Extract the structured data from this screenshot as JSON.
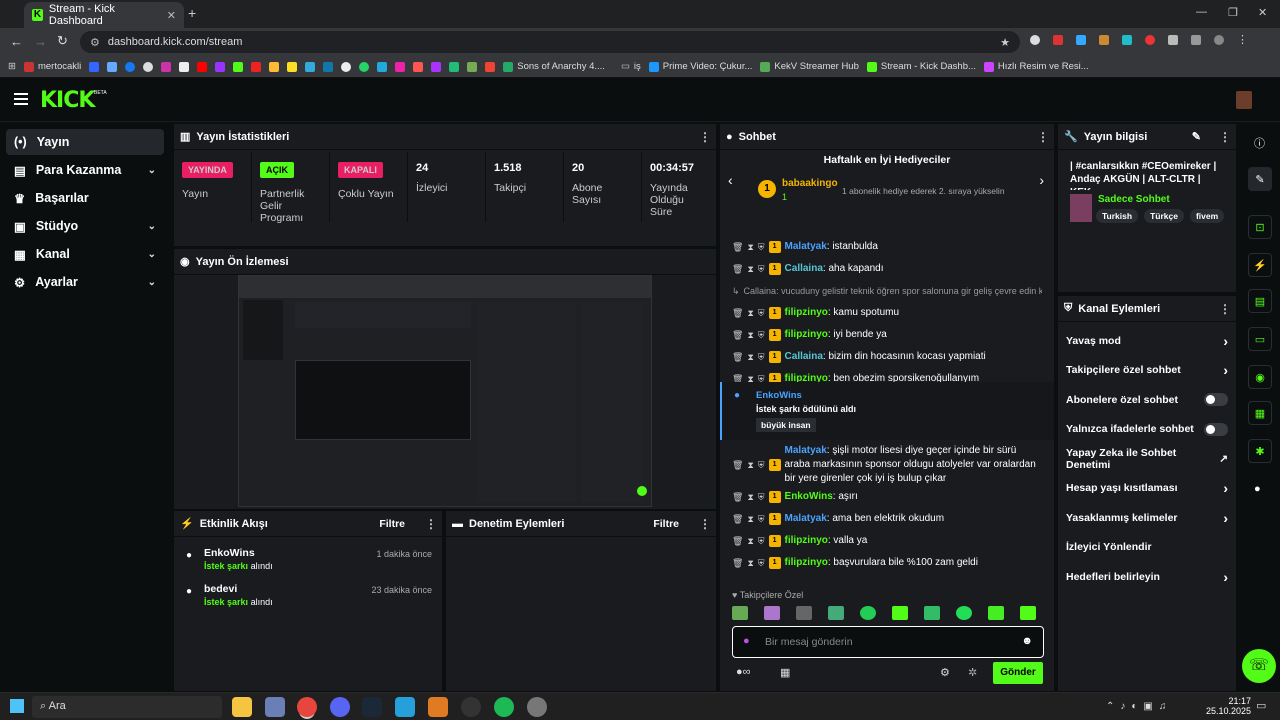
{
  "browser": {
    "tab_title": "Stream - Kick Dashboard",
    "url": "dashboard.kick.com/stream",
    "bookmarks": [
      "mertocakli",
      "Sons of Anarchy 4....",
      "iş",
      "Prime Video: Çukur...",
      "KekV Streamer Hub",
      "Stream - Kick Dashb...",
      "Hızlı Resim ve Resi..."
    ]
  },
  "app": {
    "logo": "KICK",
    "logo_badge": "BETA"
  },
  "sidebar": {
    "items": [
      {
        "label": "Yayın"
      },
      {
        "label": "Para Kazanma"
      },
      {
        "label": "Başarılar"
      },
      {
        "label": "Stüdyo"
      },
      {
        "label": "Kanal"
      },
      {
        "label": "Ayarlar"
      }
    ]
  },
  "stats": {
    "title": "Yayın İstatistikleri",
    "items": [
      {
        "pill": "YAYINDA",
        "label": "Yayın"
      },
      {
        "pill": "AÇIK",
        "label": "Partnerlik Gelir Programı"
      },
      {
        "pill": "KAPALI",
        "label": "Çoklu Yayın"
      },
      {
        "value": "24",
        "label": "İzleyici"
      },
      {
        "value": "1.518",
        "label": "Takipçi"
      },
      {
        "value": "20",
        "label": "Abone Sayısı"
      },
      {
        "value": "00:34:57",
        "label": "Yayında Olduğu Süre"
      }
    ]
  },
  "preview": {
    "title": "Yayın Ön İzlemesi"
  },
  "activity": {
    "title": "Etkinlik Akışı",
    "filter": "Filtre",
    "items": [
      {
        "user": "EnkoWins",
        "time": "1 dakika önce",
        "highlight": "İstek şarkı",
        "rest": "alındı"
      },
      {
        "user": "bedevi",
        "time": "23 dakika önce",
        "highlight": "İstek şarkı",
        "rest": "alındı"
      }
    ]
  },
  "moderation": {
    "title": "Denetim Eylemleri",
    "filter": "Filtre"
  },
  "chat": {
    "title": "Sohbet",
    "gifters_title": "Haftalık en İyi Hediyeciler",
    "top_gifter": "babaakingo",
    "top_gifter_count": "1",
    "gift_note": "1 abonelik hediye ederek 2. sıraya yükselin",
    "messages": [
      {
        "user": "Malatyak",
        "color": "#4aa3ff",
        "text": ": istanbulda"
      },
      {
        "user": "Callaina",
        "color": "#57c7d6",
        "text": ": aha kapandı"
      },
      {
        "reply": "Callaina: vucuduny gelistir teknik öğren spor salonuna gir geliş çevre edin k..."
      },
      {
        "user": "filipzinyo",
        "color": "#53fc18",
        "text": ": kamu spotumu"
      },
      {
        "user": "filipzinyo",
        "color": "#53fc18",
        "text": ": iyi bende ya"
      },
      {
        "user": "Callaina",
        "color": "#57c7d6",
        "text": ": bizim din hocasının kocası yapmiati"
      },
      {
        "user": "filipzinyo",
        "color": "#53fc18",
        "text": ": ben obezim sporsikenoğullanyım"
      }
    ],
    "reward": {
      "user": "EnkoWins",
      "text": "İstek şarkı ödülünü aldı",
      "song": "büyük insan"
    },
    "messages2": [
      {
        "user": "Malatyak",
        "color": "#4aa3ff",
        "text": ": şişli motor lisesi diye geçer içinde bir sürü araba markasının sponsor oldugu atolyeler var oralardan bir yere girenler çok iyi iş bulup çıkar"
      },
      {
        "user": "EnkoWins",
        "color": "#53fc18",
        "text": ": aşırı"
      },
      {
        "user": "Malatyak",
        "color": "#4aa3ff",
        "text": ": ama ben elektrik okudum"
      },
      {
        "user": "filipzinyo",
        "color": "#53fc18",
        "text": ": valla ya"
      },
      {
        "user": "filipzinyo",
        "color": "#53fc18",
        "text": ": başvurulara bile %100 zam geldi"
      }
    ],
    "followers_only": "Takipçilere Özel",
    "placeholder": "Bir mesaj gönderin",
    "send": "Gönder"
  },
  "stream_info": {
    "title": "Yayın bilgisi",
    "stream_title": "| #canlarsıkkın #CEOemireker | Andaç AKGÜN | ALT-CLTR | KEK...",
    "category": "Sadece Sohbet",
    "tags": [
      "Turkish",
      "Türkçe",
      "fivem"
    ]
  },
  "channel_actions": {
    "title": "Kanal Eylemleri",
    "items": [
      {
        "label": "Yavaş mod",
        "type": "chevron"
      },
      {
        "label": "Takipçilere özel sohbet",
        "type": "chevron"
      },
      {
        "label": "Abonelere özel sohbet",
        "type": "toggle"
      },
      {
        "label": "Yalnızca ifadelerle sohbet",
        "type": "toggle"
      },
      {
        "label": "Yapay Zeka ile Sohbet Denetimi",
        "type": "external"
      },
      {
        "label": "Hesap yaşı kısıtlaması",
        "type": "chevron"
      },
      {
        "label": "Yasaklanmış kelimeler",
        "type": "chevron"
      },
      {
        "label": "İzleyici Yönlendir",
        "type": "none"
      },
      {
        "label": "Hedefleri belirleyin",
        "type": "chevron"
      }
    ]
  },
  "taskbar": {
    "search": "Ara",
    "time": "21:17",
    "date": "25.10.2025"
  }
}
